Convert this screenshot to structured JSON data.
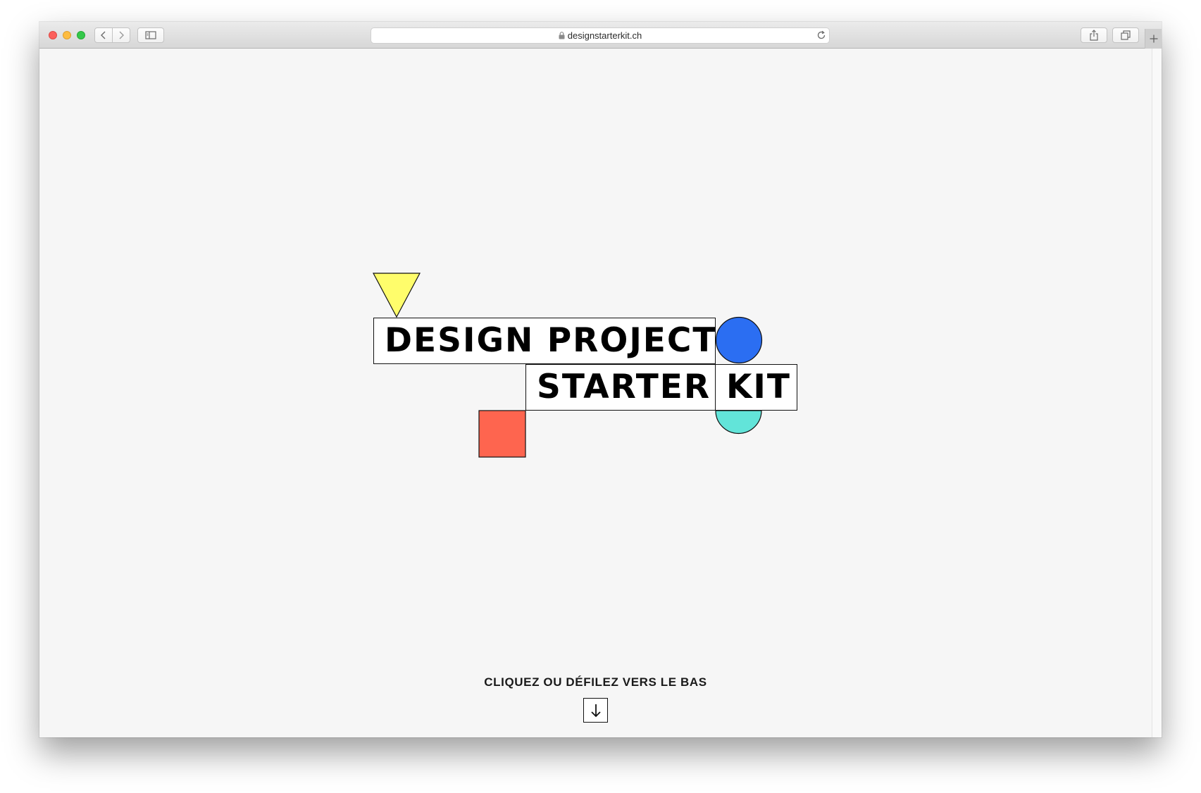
{
  "browser": {
    "url": "designstarterkit.ch",
    "traffic_lights": [
      "close",
      "minimize",
      "zoom"
    ],
    "toolbar_icons": [
      "back-icon",
      "forward-icon",
      "sidebar-icon",
      "share-icon",
      "tabs-icon",
      "plus-icon"
    ]
  },
  "logo": {
    "words": [
      "DESIGN PROJECT",
      "STARTER",
      "KIT"
    ],
    "shapes": {
      "triangle_color": "#fffd6b",
      "blue_circle_color": "#2b6ef2",
      "teal_semicircle_color": "#62e4d9",
      "red_square_color": "#fe654f"
    }
  },
  "cta": {
    "label": "CLIQUEZ OU DÉFILEZ VERS LE BAS",
    "arrow_icon": "arrow-down-icon"
  }
}
